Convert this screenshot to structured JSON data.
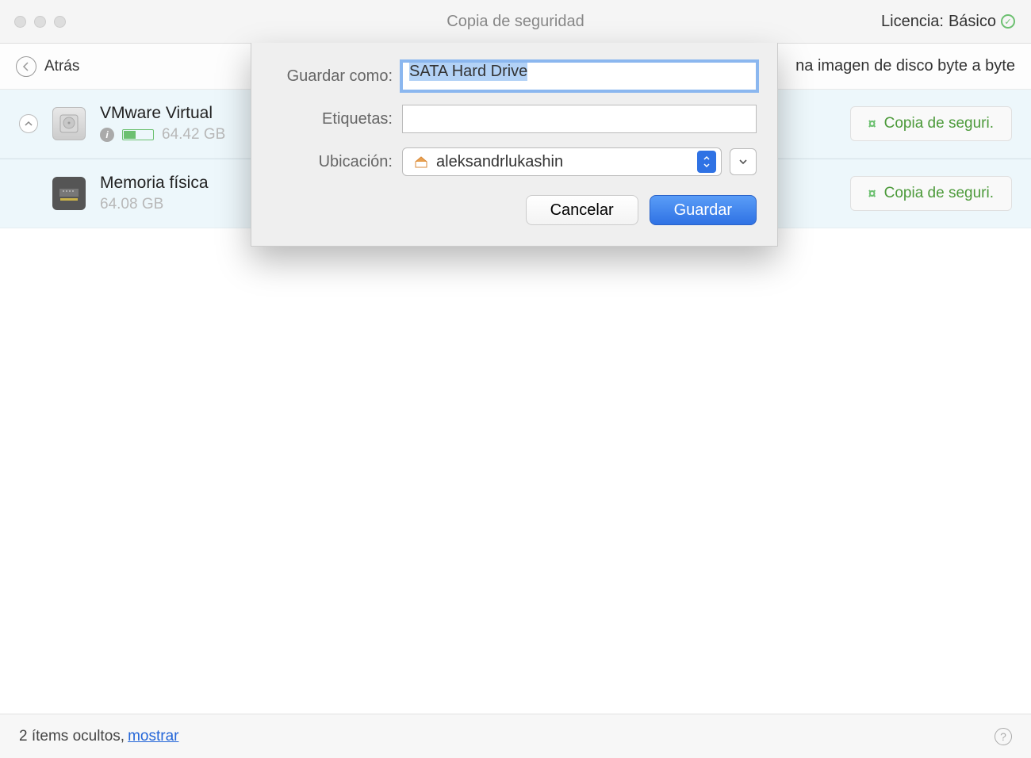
{
  "window": {
    "title": "Copia de seguridad",
    "license_prefix": "Licencia: ",
    "license_level": "Básico"
  },
  "toolbar": {
    "back_label": "Atrás",
    "right_text": "na imagen de disco byte a byte"
  },
  "disks": [
    {
      "name": "VMware Virtual",
      "size": "64.42 GB",
      "icon": "hdd",
      "has_info": true,
      "has_batt": true,
      "backup_label": "Copia de seguri.",
      "has_collapse": true
    },
    {
      "name": "Memoria física",
      "size": "64.08 GB",
      "icon": "ram",
      "has_info": false,
      "has_batt": false,
      "backup_label": "Copia de seguri.",
      "has_collapse": false
    }
  ],
  "dialog": {
    "save_as_label": "Guardar como:",
    "save_as_value": "SATA Hard Drive",
    "tags_label": "Etiquetas:",
    "tags_value": "",
    "location_label": "Ubicación:",
    "location_value": "aleksandrlukashin",
    "cancel_label": "Cancelar",
    "save_label": "Guardar"
  },
  "status": {
    "hidden_text": "2 ítems ocultos, ",
    "show_link": "mostrar"
  }
}
